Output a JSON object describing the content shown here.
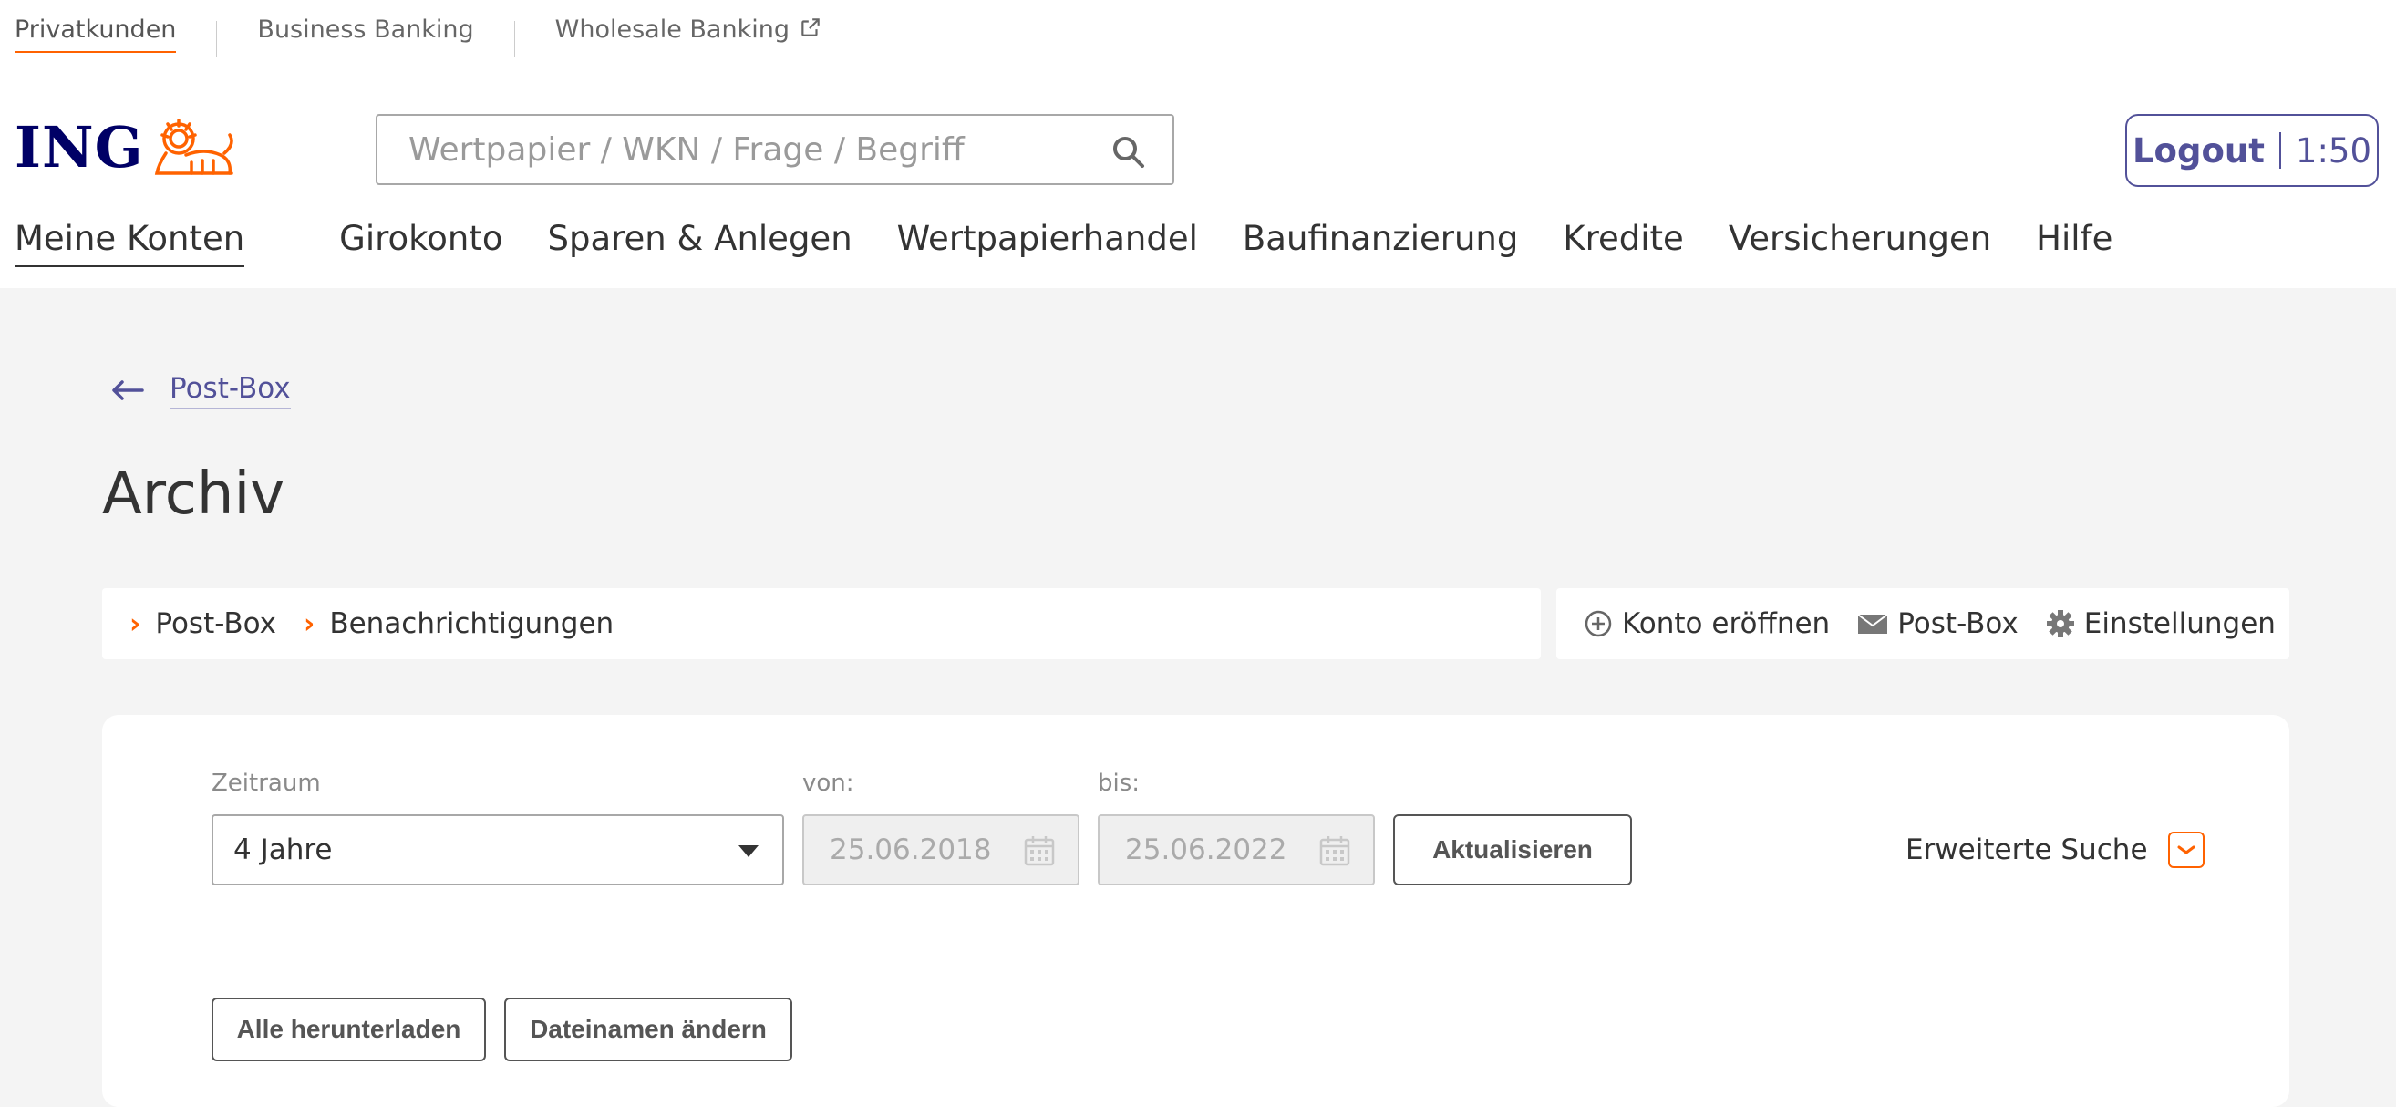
{
  "segments": [
    {
      "label": "Privatkunden",
      "active": true
    },
    {
      "label": "Business Banking"
    },
    {
      "label": "Wholesale Banking",
      "external": true
    }
  ],
  "brand": {
    "logo_text": "ING",
    "accent": "#ff6200",
    "primary": "#525199",
    "navy": "#000066"
  },
  "search": {
    "placeholder": "Wertpapier / WKN / Frage / Begriff",
    "icon": "search-icon"
  },
  "logout": {
    "label": "Logout",
    "timer": "1:50"
  },
  "main_nav": [
    {
      "label": "Meine Konten",
      "active": true
    },
    {
      "label": "Girokonto"
    },
    {
      "label": "Sparen & Anlegen"
    },
    {
      "label": "Wertpapierhandel"
    },
    {
      "label": "Baufinanzierung"
    },
    {
      "label": "Kredite"
    },
    {
      "label": "Versicherungen"
    },
    {
      "label": "Hilfe"
    }
  ],
  "back_link": {
    "label": "Post-Box",
    "icon": "arrow-left-icon"
  },
  "page_title": "Archiv",
  "breadcrumb": [
    "Post-Box",
    "Benachrichtigungen"
  ],
  "quick_links": [
    {
      "label": "Konto eröffnen",
      "icon": "plus-circle-icon"
    },
    {
      "label": "Post-Box",
      "icon": "envelope-icon"
    },
    {
      "label": "Einstellungen",
      "icon": "gear-icon"
    }
  ],
  "filter": {
    "period_label": "Zeitraum",
    "period_value": "4 Jahre",
    "from_label": "von:",
    "from_value": "25.06.2018",
    "to_label": "bis:",
    "to_value": "25.06.2022",
    "refresh_label": "Aktualisieren",
    "advanced_label": "Erweiterte Suche"
  },
  "actions": {
    "download_all": "Alle herunterladen",
    "rename_files": "Dateinamen ändern"
  }
}
